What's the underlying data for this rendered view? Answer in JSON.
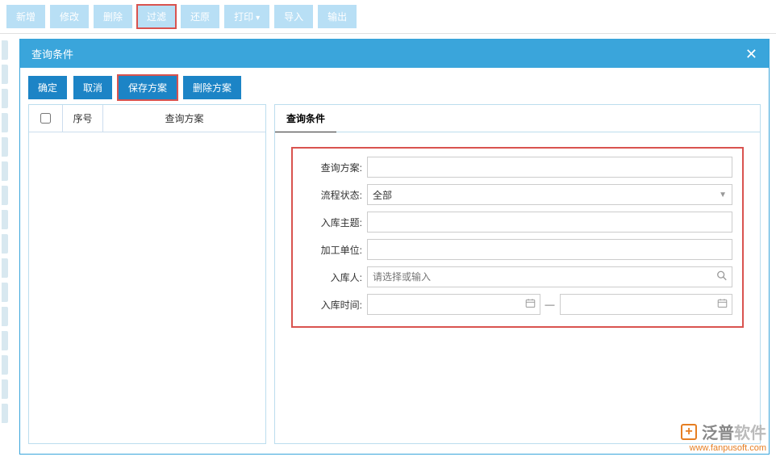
{
  "topToolbar": {
    "new": "新增",
    "edit": "修改",
    "delete": "删除",
    "filter": "过滤",
    "restore": "还原",
    "print": "打印",
    "import": "导入",
    "export": "输出"
  },
  "modal": {
    "title": "查询条件",
    "buttons": {
      "confirm": "确定",
      "cancel": "取消",
      "saveScheme": "保存方案",
      "deleteScheme": "删除方案"
    }
  },
  "leftGrid": {
    "seqHeader": "序号",
    "schemeHeader": "查询方案"
  },
  "rightPanel": {
    "tab": "查询条件",
    "form": {
      "schemeLabel": "查询方案:",
      "schemeValue": "",
      "statusLabel": "流程状态:",
      "statusValue": "全部",
      "subjectLabel": "入库主题:",
      "subjectValue": "",
      "unitLabel": "加工单位:",
      "unitValue": "",
      "personLabel": "入库人:",
      "personPlaceholder": "请选择或输入",
      "timeLabel": "入库时间:",
      "dateFrom": "",
      "dateTo": ""
    }
  },
  "watermark": {
    "brand1": "泛普",
    "brand2": "软件",
    "url": "www.fanpusoft.com"
  }
}
